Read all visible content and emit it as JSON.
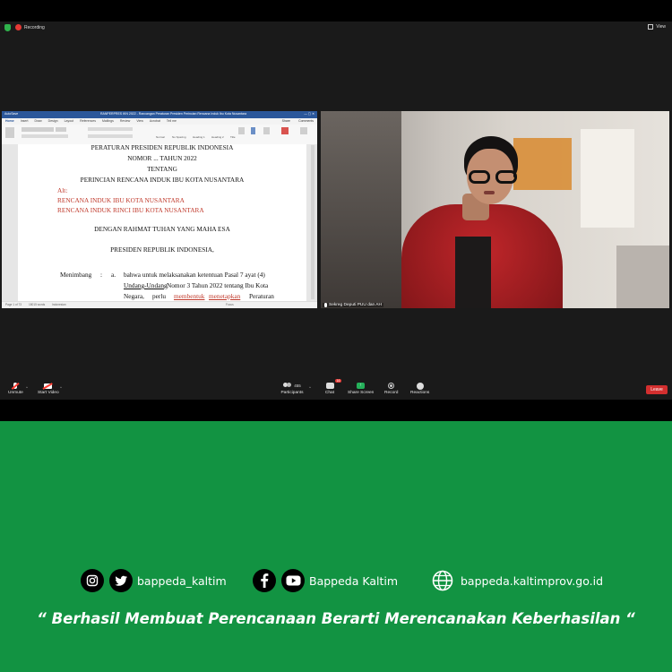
{
  "zoom": {
    "recording_label": "Recording",
    "view_label": "View",
    "participant_name": "Sekreg Deputi PUU dan AH",
    "controls": {
      "unmute": "Unmute",
      "start_video": "Start Video",
      "participants": "Participants",
      "participants_count": "455",
      "chat": "Chat",
      "chat_badge": "16",
      "share_screen": "Share Screen",
      "record": "Record",
      "reactions": "Reactions",
      "leave": "Leave"
    }
  },
  "word": {
    "autosave": "AutoSave",
    "filename": "RANPERPRES IKN 2022 - Rancangan Peraturan Presiden Perincian Rencana Induk Ibu Kota Nusantara",
    "tabs": [
      "Home",
      "Insert",
      "Draw",
      "Design",
      "Layout",
      "References",
      "Mailings",
      "Review",
      "View",
      "Acrobat",
      "Tell me"
    ],
    "active_tab": "Home",
    "share": "Share",
    "comments": "Comments",
    "ribbon_styles": [
      "Normal",
      "No Spacing",
      "Heading 1",
      "Heading 2",
      "Title"
    ],
    "ribbon_tools": [
      "Styles Pane",
      "Dictate",
      "Editor",
      "Create and Share Adobe PDF",
      "Request Signatures"
    ],
    "status": {
      "page": "Page 1 of 73",
      "words": "18015 words",
      "language": "Indonesian",
      "focus": "Focus"
    },
    "document": {
      "line1": "PERATURAN PRESIDEN REPUBLIK INDONESIA",
      "line2": "NOMOR ... TAHUN 2022",
      "line3": "TENTANG",
      "line4": "PERINCIAN RENCANA INDUK IBU KOTA NUSANTARA",
      "alt_label": "Alt:",
      "alt1": "RENCANA INDUK IBU KOTA NUSANTARA",
      "alt2": "RENCANA INDUK RINCI IBU KOTA NUSANTARA",
      "grace": "DENGAN RAHMAT TUHAN YANG MAHA ESA",
      "president": "PRESIDEN REPUBLIK INDONESIA,",
      "menimbang": "Menimbang",
      "colon": ":",
      "item_letter": "a.",
      "para1": "bahwa untuk melaksanakan ketentuan Pasal 7 ayat (4)",
      "para2_a": "Undang-Undang",
      "para2_b": " Nomor 3 Tahun 2022 tentang Ibu Kota",
      "para3_a": "Negara,",
      "para3_b": "perlu",
      "para3_c": "membentuk",
      "para3_d": "menetapkan",
      "para3_e": "Peraturan"
    }
  },
  "footer": {
    "instagram_handle": "bappeda_kaltim",
    "facebook_youtube_name": "Bappeda Kaltim",
    "website": "bappeda.kaltimprov.go.id",
    "tagline": "“ Berhasil  Membuat Perencanaan Berarti Merencanakan Keberhasilan “"
  },
  "colors": {
    "brand_green": "#129342",
    "zoom_dark": "#1a1a1a",
    "word_blue": "#2b579a",
    "tracked_change_red": "#c0392b",
    "leave_red": "#d32f2f",
    "share_green": "#25b05a"
  },
  "icons": [
    "shield-icon",
    "record-icon",
    "view-icon",
    "microphone-muted-icon",
    "video-off-icon",
    "participants-icon",
    "chat-icon",
    "share-screen-icon",
    "record-button-icon",
    "reactions-icon",
    "instagram-icon",
    "twitter-icon",
    "facebook-icon",
    "youtube-icon",
    "globe-icon"
  ]
}
